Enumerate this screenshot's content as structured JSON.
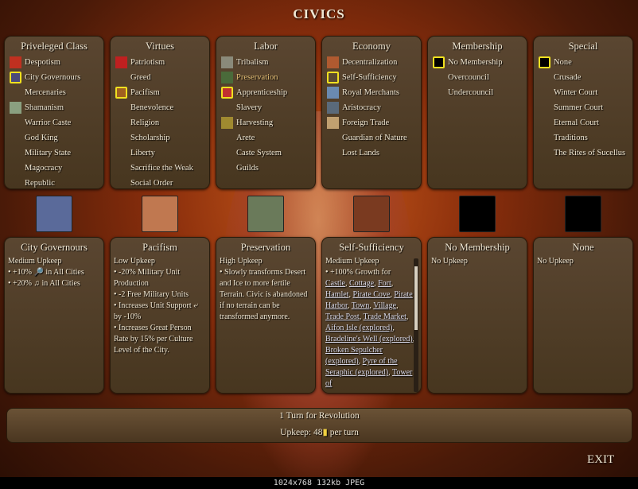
{
  "title": "CIVICS",
  "categories": [
    {
      "name": "Priveleged Class",
      "items": [
        {
          "label": "Despotism",
          "icon": "despotism-icon",
          "color": "#c03020"
        },
        {
          "label": "City Governours",
          "icon": "city-governours-icon",
          "color": "#4a4a7a",
          "selected": true
        },
        {
          "label": "Mercenaries"
        },
        {
          "label": "Shamanism",
          "icon": "shamanism-icon",
          "color": "#8aa080"
        },
        {
          "label": "Warrior Caste"
        },
        {
          "label": "God King"
        },
        {
          "label": "Military State"
        },
        {
          "label": "Magocracy"
        },
        {
          "label": "Republic"
        }
      ]
    },
    {
      "name": "Virtues",
      "items": [
        {
          "label": "Patriotism",
          "icon": "patriotism-icon",
          "color": "#c02020"
        },
        {
          "label": "Greed"
        },
        {
          "label": "Pacifism",
          "icon": "pacifism-icon",
          "color": "#a06020",
          "selected": true
        },
        {
          "label": "Benevolence"
        },
        {
          "label": "Religion"
        },
        {
          "label": "Scholarship"
        },
        {
          "label": "Liberty"
        },
        {
          "label": "Sacrifice the Weak"
        },
        {
          "label": "Social Order"
        }
      ]
    },
    {
      "name": "Labor",
      "items": [
        {
          "label": "Tribalism",
          "icon": "tribalism-icon",
          "color": "#8a8a7a"
        },
        {
          "label": "Preservation",
          "icon": "preservation-icon",
          "color": "#4a6a3a",
          "highlighted": true
        },
        {
          "label": "Apprenticeship",
          "icon": "apprenticeship-icon",
          "color": "#c03030",
          "selected": true
        },
        {
          "label": "Slavery"
        },
        {
          "label": "Harvesting",
          "icon": "harvesting-icon",
          "color": "#a08a30"
        },
        {
          "label": "Arete"
        },
        {
          "label": "Caste System"
        },
        {
          "label": "Guilds"
        }
      ]
    },
    {
      "name": "Economy",
      "items": [
        {
          "label": "Decentralization",
          "icon": "decentralization-icon",
          "color": "#b05a30"
        },
        {
          "label": "Self-Sufficiency",
          "icon": "self-sufficiency-icon",
          "color": "#5a4a30",
          "selected": true
        },
        {
          "label": "Royal Merchants",
          "icon": "royal-merchants-icon",
          "color": "#6a8ab0"
        },
        {
          "label": "Aristocracy",
          "icon": "aristocracy-icon",
          "color": "#5a6a7a"
        },
        {
          "label": "Foreign Trade",
          "icon": "foreign-trade-icon",
          "color": "#c0a070"
        },
        {
          "label": "Guardian of Nature"
        },
        {
          "label": "Lost Lands"
        }
      ]
    },
    {
      "name": "Membership",
      "items": [
        {
          "label": "No Membership",
          "icon": "no-membership-icon",
          "color": "#000000",
          "selected": true
        },
        {
          "label": "Overcouncil"
        },
        {
          "label": "Undercouncil"
        }
      ]
    },
    {
      "name": "Special",
      "items": [
        {
          "label": "None",
          "icon": "none-icon",
          "color": "#000000",
          "selected": true
        },
        {
          "label": "Crusade"
        },
        {
          "label": "Winter Court"
        },
        {
          "label": "Summer Court"
        },
        {
          "label": "Eternal Court"
        },
        {
          "label": "Traditions"
        },
        {
          "label": "The Rites of Sucellus"
        }
      ]
    }
  ],
  "selected_icons": [
    {
      "icon": "city-governours-large-icon",
      "color": "#5a6a9a"
    },
    {
      "icon": "pacifism-large-icon",
      "color": "#c07850"
    },
    {
      "icon": "preservation-large-icon",
      "color": "#6a7a5a"
    },
    {
      "icon": "self-sufficiency-large-icon",
      "color": "#7a3a20"
    },
    {
      "icon": "no-membership-large-icon",
      "color": "#000000"
    },
    {
      "icon": "none-large-icon",
      "color": "#000000"
    }
  ],
  "details": [
    {
      "name": "City Governours",
      "lines": [
        "Medium Upkeep",
        "• +10% 🔎 in All Cities",
        "• +20% ♫ in All Cities"
      ]
    },
    {
      "name": "Pacifism",
      "lines": [
        "Low Upkeep",
        "• -20% Military Unit Production",
        "• -2 Free Military Units",
        "• Increases Unit Support ⤶ by -10%",
        "• Increases Great Person Rate by 15% per Culture Level of the City."
      ]
    },
    {
      "name": "Preservation",
      "lines": [
        "High Upkeep",
        "• Slowly transforms Desert and Ice to more fertile Terrain. Civic is abandoned if no terrain can be transformed anymore."
      ]
    },
    {
      "name": "Self-Sufficiency",
      "lines": [
        "Medium Upkeep",
        "• +100% Growth for"
      ],
      "links": [
        "Castle",
        "Cottage",
        "Fort",
        "Hamlet",
        "Pirate Cove",
        "Pirate Harbor",
        "Town",
        "Village",
        "Trade Post",
        "Trade Market",
        "Aifon Isle (explored)",
        "Bradeline's Well (explored)",
        "Broken Sepulcher (explored)",
        "Pyre of the Seraphic (explored)",
        "Tower of"
      ]
    },
    {
      "name": "No Membership",
      "lines": [
        "No Upkeep"
      ]
    },
    {
      "name": "None",
      "lines": [
        "No Upkeep"
      ]
    }
  ],
  "revolution": {
    "turns_text": "1 Turn for Revolution",
    "upkeep_label": "Upkeep: 48",
    "gold_icon": "gold-icon",
    "per_turn": "per turn"
  },
  "exit_label": "EXIT",
  "footer": "1024x768 132kb JPEG"
}
